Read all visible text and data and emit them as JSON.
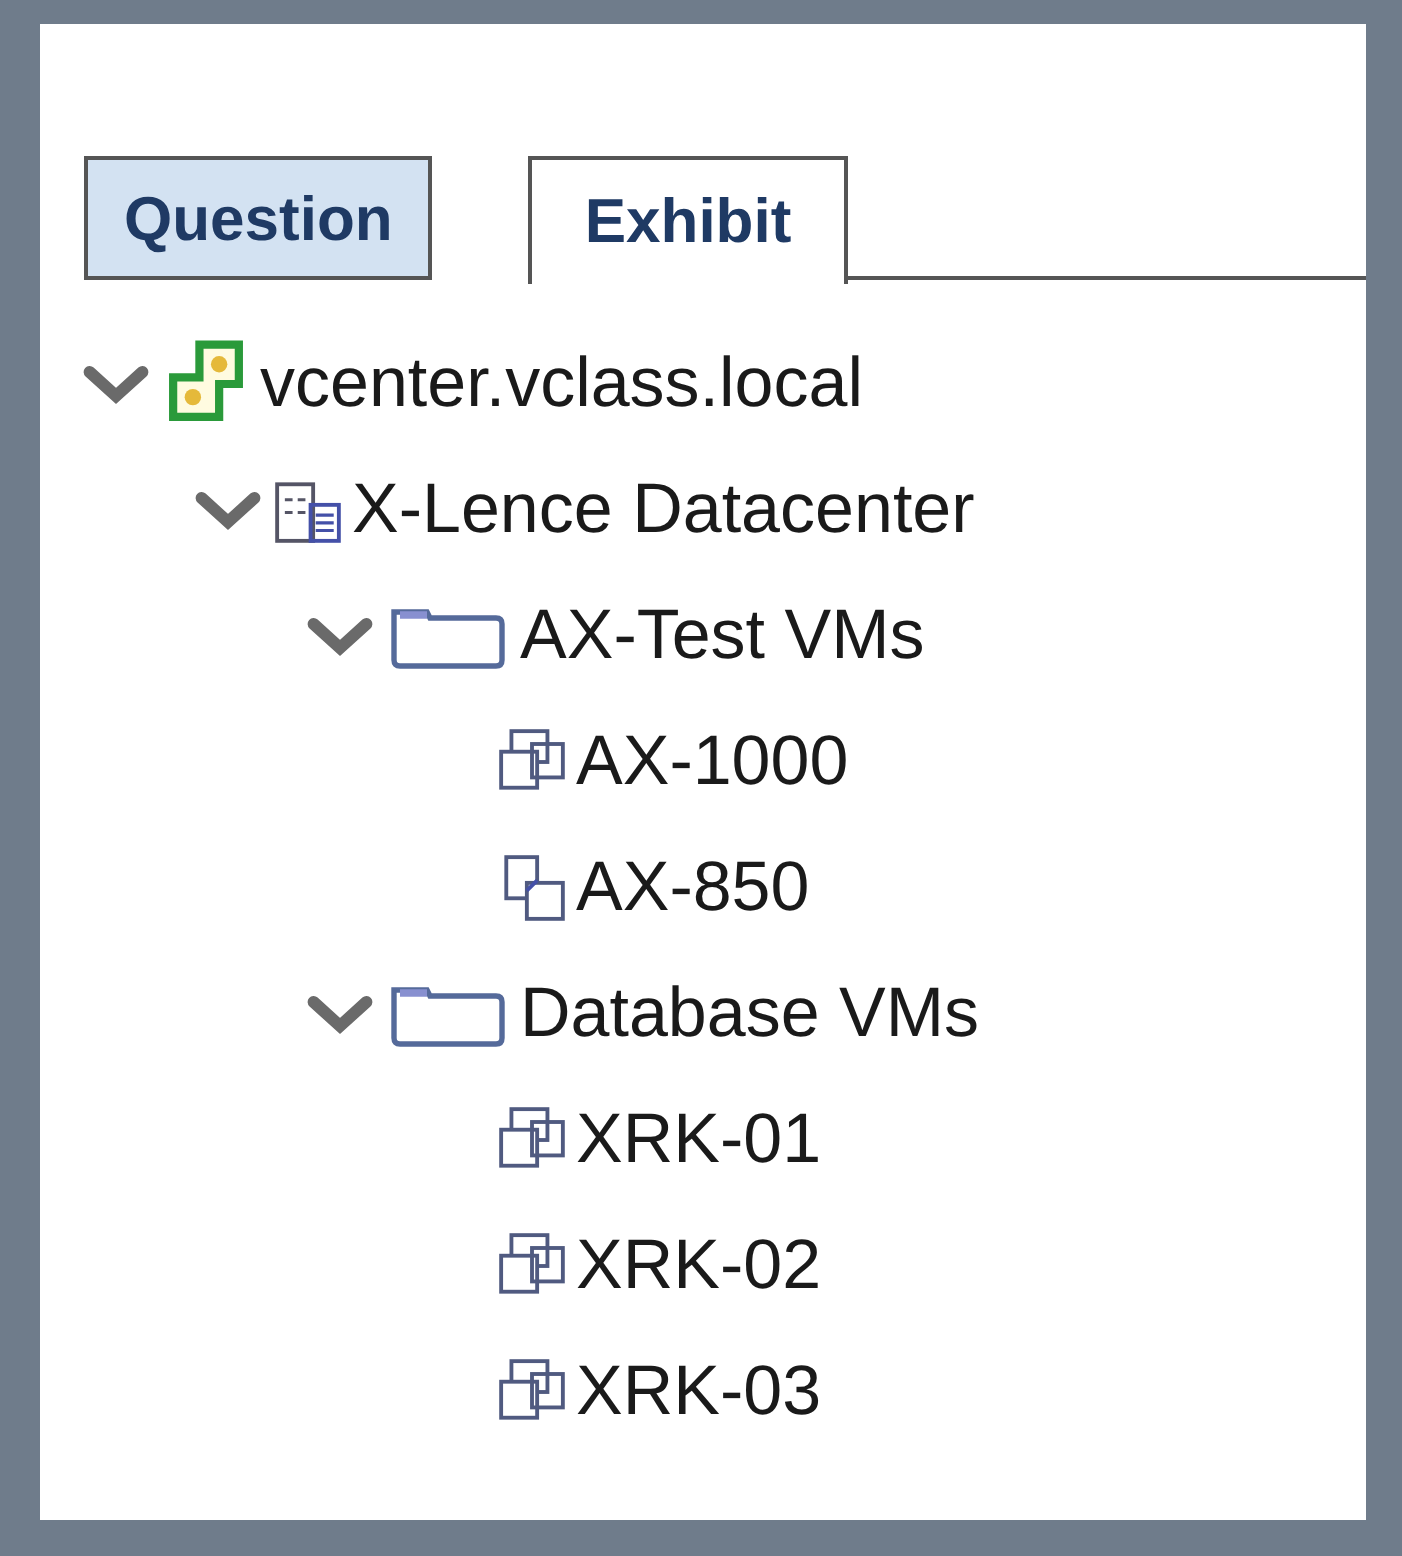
{
  "tabs": [
    {
      "label": "Question",
      "selected": false
    },
    {
      "label": "Exhibit",
      "selected": true
    }
  ],
  "tree": [
    {
      "label": "vcenter.vclass.local",
      "kind": "vcenter",
      "expanded": true,
      "children": [
        {
          "label": "X-Lence Datacenter",
          "kind": "datacenter",
          "expanded": true,
          "children": [
            {
              "label": "AX-Test VMs",
              "kind": "folder",
              "expanded": true,
              "children": [
                {
                  "label": "AX-1000",
                  "kind": "vm"
                },
                {
                  "label": "AX-850",
                  "kind": "template"
                }
              ]
            },
            {
              "label": "Database VMs",
              "kind": "folder",
              "expanded": true,
              "children": [
                {
                  "label": "XRK-01",
                  "kind": "vm"
                },
                {
                  "label": "XRK-02",
                  "kind": "vm"
                },
                {
                  "label": "XRK-03",
                  "kind": "vm"
                }
              ]
            }
          ]
        }
      ]
    }
  ]
}
